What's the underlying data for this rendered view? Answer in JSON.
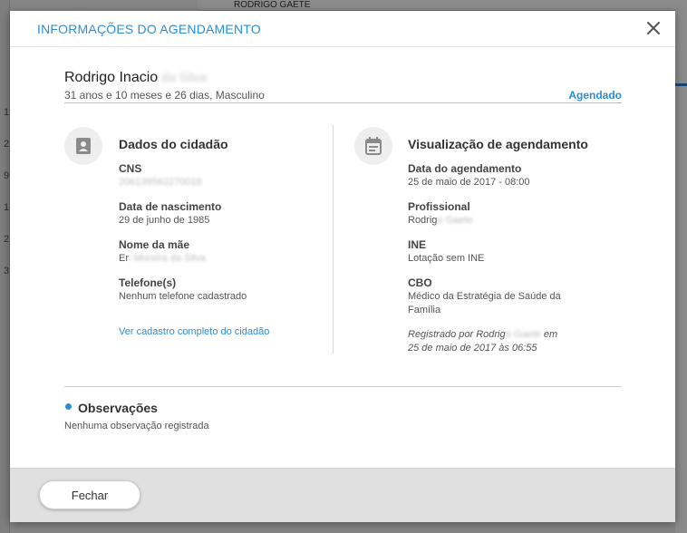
{
  "background": {
    "top_strip_text": "RODRIGO GAETE",
    "row_numbers": [
      "1",
      "2",
      "9",
      "1",
      "2",
      "3"
    ]
  },
  "modal": {
    "title": "INFORMAÇÕES DO AGENDAMENTO",
    "close_icon": "close-icon"
  },
  "patient": {
    "first_name": "Rodrigo Inacio",
    "last_name_redacted": "da Silva",
    "info": "31 anos e 10 meses e 26 dias, Masculino",
    "status": "Agendado"
  },
  "citizen": {
    "icon": "id-card-icon",
    "title": "Dados do cidadão",
    "fields": [
      {
        "label": "CNS",
        "value": "",
        "value_redacted": "206139562270018"
      },
      {
        "label": "Data de nascimento",
        "value": "29 de junho de 1985",
        "value_redacted": ""
      },
      {
        "label": "Nome da mãe",
        "value": "Er",
        "value_redacted": "i Moreira da Silva"
      },
      {
        "label": "Telefone(s)",
        "value": "Nenhum telefone cadastrado",
        "value_redacted": ""
      }
    ],
    "link": "Ver cadastro completo do cidadão"
  },
  "appointment": {
    "icon": "calendar-icon",
    "title": "Visualização de agendamento",
    "fields": [
      {
        "label": "Data do agendamento",
        "value": "25 de maio de 2017 - 08:00",
        "value_redacted": ""
      },
      {
        "label": "Profissional",
        "value": "Rodrig",
        "value_redacted": "o Gaete"
      },
      {
        "label": "INE",
        "value": "Lotação sem INE",
        "value_redacted": ""
      },
      {
        "label": "CBO",
        "value": "Médico da Estratégia de Saúde da Família",
        "value_redacted": ""
      }
    ],
    "registered_prefix": "Registrado por Rodrig",
    "registered_redacted": "o Gaete",
    "registered_suffix": " em",
    "registered_date": "25 de maio de 2017 às 06:55"
  },
  "observations": {
    "title": "Observações",
    "text": "Nenhuma observação registrada"
  },
  "footer": {
    "close_button": "Fechar"
  },
  "colors": {
    "accent": "#2b8dd6",
    "overlay": "rgba(0,0,0,0.45)",
    "footer_bg": "#e0e0e0"
  }
}
